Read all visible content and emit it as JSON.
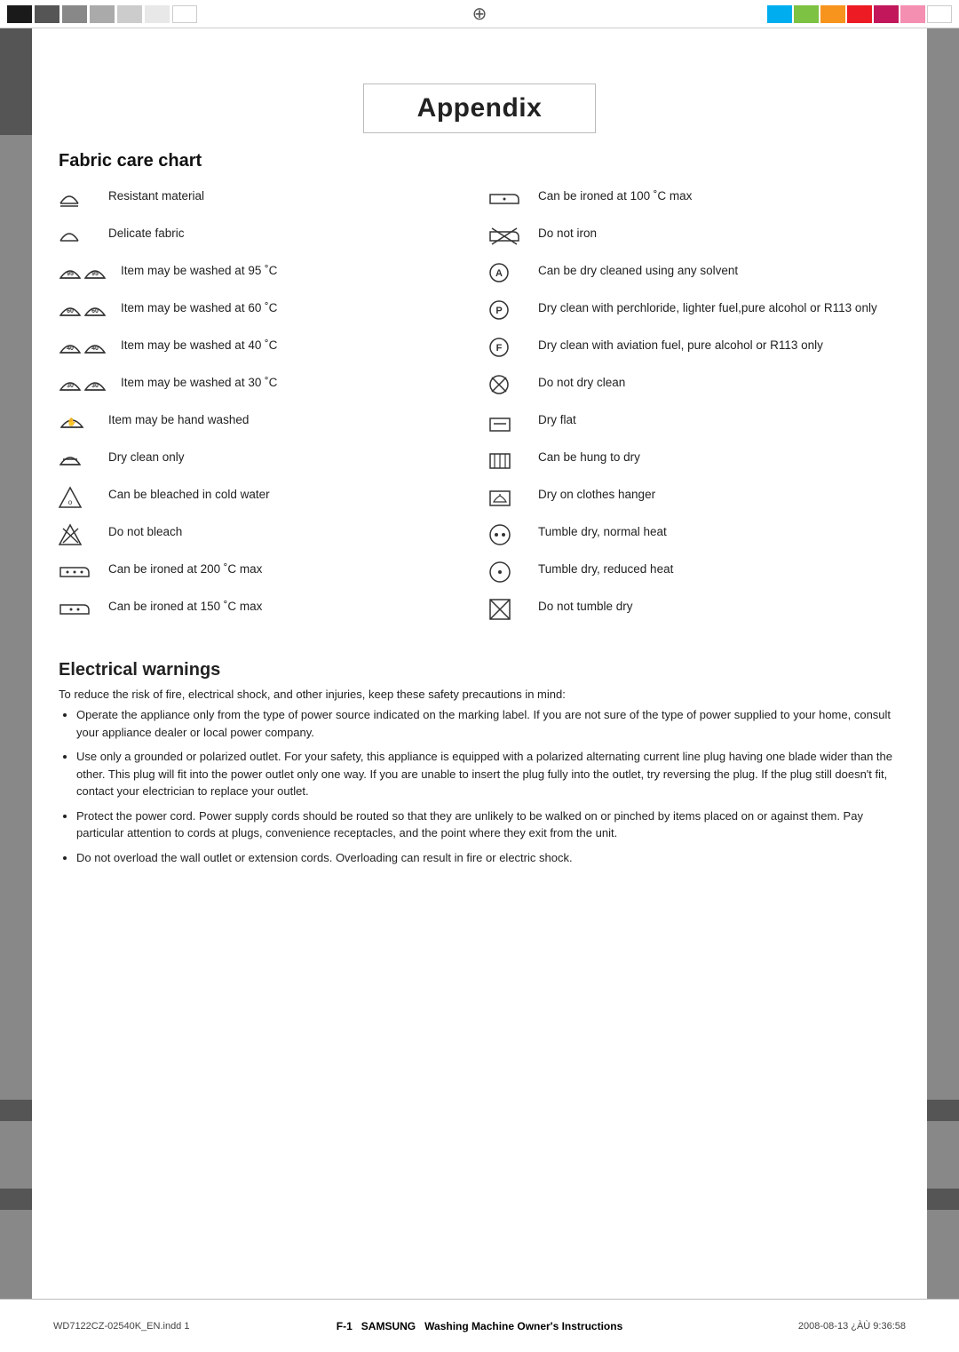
{
  "page": {
    "title": "Appendix"
  },
  "topbar": {
    "crosshair": "⊕"
  },
  "fabric_care": {
    "section_title": "Fabric care chart",
    "left_items": [
      {
        "icon_type": "wash-resistant",
        "label": "Resistant material"
      },
      {
        "icon_type": "wash-delicate",
        "label": "Delicate fabric"
      },
      {
        "icon_type": "wash-95",
        "label": "Item may be washed at 95 ˚C"
      },
      {
        "icon_type": "wash-60",
        "label": "Item may be washed at 60 ˚C"
      },
      {
        "icon_type": "wash-40",
        "label": "Item may be washed at 40 ˚C"
      },
      {
        "icon_type": "wash-30",
        "label": "Item may be washed at 30 ˚C"
      },
      {
        "icon_type": "hand-wash",
        "label": "Item may be hand washed"
      },
      {
        "icon_type": "dry-clean-only",
        "label": "Dry clean only"
      },
      {
        "icon_type": "bleach-cold",
        "label": "Can be bleached in cold water"
      },
      {
        "icon_type": "no-bleach",
        "label": "Do not bleach"
      },
      {
        "icon_type": "iron-200",
        "label": "Can be ironed at 200 ˚C max"
      },
      {
        "icon_type": "iron-150",
        "label": "Can be ironed at 150 ˚C max"
      }
    ],
    "right_items": [
      {
        "icon_type": "iron-100",
        "label": "Can be ironed at 100 ˚C max"
      },
      {
        "icon_type": "no-iron",
        "label": "Do not iron"
      },
      {
        "icon_type": "dry-clean-any",
        "label": "Can be dry cleaned using any solvent"
      },
      {
        "icon_type": "dry-clean-p",
        "label": "Dry clean with perchloride, lighter fuel,pure alcohol or R113 only"
      },
      {
        "icon_type": "dry-clean-f",
        "label": "Dry clean with aviation fuel, pure alcohol or R113 only"
      },
      {
        "icon_type": "no-dry-clean",
        "label": "Do not dry clean"
      },
      {
        "icon_type": "dry-flat",
        "label": "Dry flat"
      },
      {
        "icon_type": "hung-dry",
        "label": "Can be hung to dry"
      },
      {
        "icon_type": "hanger-dry",
        "label": "Dry on clothes hanger"
      },
      {
        "icon_type": "tumble-normal",
        "label": "Tumble dry, normal heat"
      },
      {
        "icon_type": "tumble-reduced",
        "label": "Tumble dry, reduced heat"
      },
      {
        "icon_type": "no-tumble",
        "label": "Do not tumble dry"
      }
    ]
  },
  "electrical": {
    "section_title": "Electrical warnings",
    "intro": "To reduce the risk of fire, electrical shock, and other injuries, keep these safety precautions in mind:",
    "bullets": [
      "Operate the appliance only from the type of power source indicated on the marking label. If you are not sure of the type of power supplied to your home, consult your appliance dealer or local power company.",
      "Use only a grounded or polarized outlet. For your safety, this appliance is equipped with a polarized alternating current line plug having one blade wider than the other. This plug will fit into the power outlet only one way. If you are unable to insert the plug fully into the outlet, try reversing the plug. If the plug still doesn't fit, contact your electrician to replace your outlet.",
      "Protect the power cord. Power supply cords should be routed so that they are unlikely to be walked on or pinched by items placed on or against them. Pay particular attention to cords at plugs, convenience receptacles, and the point where they exit from the unit.",
      "Do not overload the wall outlet or extension cords. Overloading can result in fire or electric shock."
    ]
  },
  "footer": {
    "page_label": "F-1",
    "brand": "SAMSUNG",
    "doc_title": "Washing Machine Owner's Instructions",
    "file_info": "WD7122CZ-02540K_EN.indd  1",
    "date_info": "2008-08-13  ¿ÀÙ 9:36:58"
  }
}
